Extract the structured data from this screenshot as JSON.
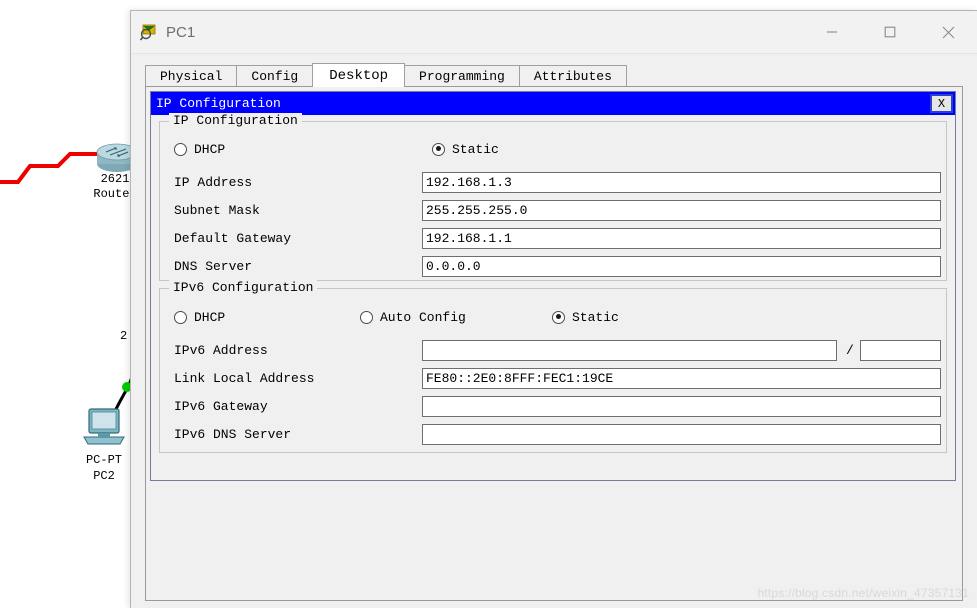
{
  "window": {
    "title": "PC1",
    "icon": "packet-tracer-device-icon",
    "minimize_label": "—",
    "maximize_label": "□",
    "close_label": "✕"
  },
  "tabs": [
    {
      "label": "Physical",
      "active": false
    },
    {
      "label": "Config",
      "active": false
    },
    {
      "label": "Desktop",
      "active": true
    },
    {
      "label": "Programming",
      "active": false
    },
    {
      "label": "Attributes",
      "active": false
    }
  ],
  "dialog": {
    "title": "IP Configuration",
    "close_label": "X",
    "titlebar_color": "#0000ff",
    "ipv4": {
      "legend": "IP Configuration",
      "modes": [
        {
          "label": "DHCP",
          "checked": false
        },
        {
          "label": "Static",
          "checked": true
        }
      ],
      "fields": [
        {
          "label": "IP Address",
          "value": "192.168.1.3"
        },
        {
          "label": "Subnet Mask",
          "value": "255.255.255.0"
        },
        {
          "label": "Default Gateway",
          "value": "192.168.1.1"
        },
        {
          "label": "DNS Server",
          "value": "0.0.0.0"
        }
      ]
    },
    "ipv6": {
      "legend": "IPv6 Configuration",
      "modes": [
        {
          "label": "DHCP",
          "checked": false
        },
        {
          "label": "Auto Config",
          "checked": false
        },
        {
          "label": "Static",
          "checked": true
        }
      ],
      "address_label": "IPv6 Address",
      "address_value": "",
      "prefix_separator": "/",
      "prefix_value": "",
      "fields": [
        {
          "label": "Link Local Address",
          "value": "FE80::2E0:8FFF:FEC1:19CE"
        },
        {
          "label": "IPv6 Gateway",
          "value": ""
        },
        {
          "label": "IPv6 DNS Server",
          "value": ""
        }
      ]
    }
  },
  "canvas": {
    "router": {
      "label_line1": "2621",
      "label_line2": "Router"
    },
    "pc": {
      "label_line1": "PC-PT",
      "label_line2": "PC2"
    },
    "stray_label": "2",
    "link_red_color": "#ee0000",
    "link_status_color": "#00cc00"
  },
  "watermark": "https://blog.csdn.net/weixin_47357131"
}
